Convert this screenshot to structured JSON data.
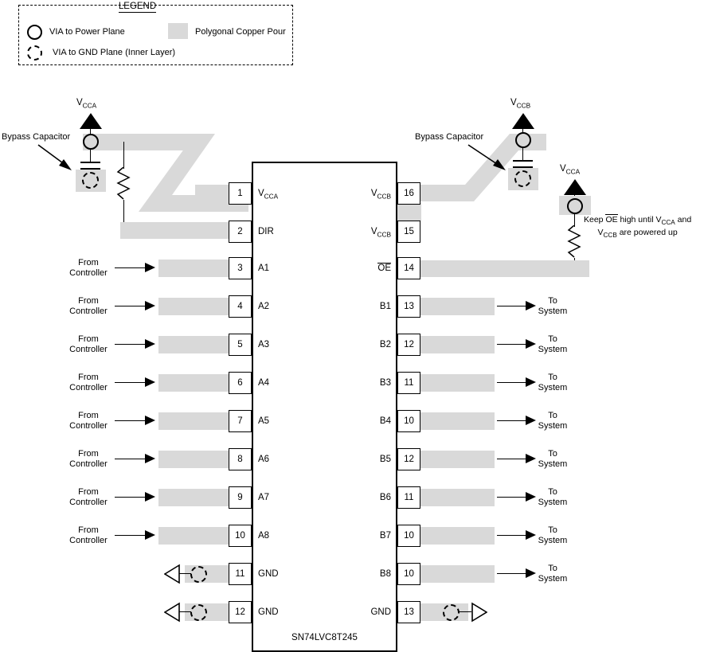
{
  "legend": {
    "title": "LEGEND",
    "items": [
      {
        "icon": "via-power-plane-icon",
        "label": "VIA to Power Plane"
      },
      {
        "icon": "via-gnd-plane-icon",
        "label": "VIA to GND Plane (Inner Layer)"
      },
      {
        "icon": "copper-pour-swatch",
        "label": "Polygonal Copper Pour"
      }
    ]
  },
  "colors": {
    "copper_pour": "#d9d9d9",
    "outline": "#000000",
    "background": "#ffffff"
  },
  "device": {
    "part_number": "SN74LVC8T245"
  },
  "power": {
    "left_rail_label": "V",
    "left_rail_sub": "CCA",
    "right_rail_label": "V",
    "right_rail_sub": "CCB",
    "pullup_rail_label": "V",
    "pullup_rail_sub": "CCA",
    "bypass_callout_left": "Bypass Capacitor",
    "bypass_callout_right": "Bypass Capacitor"
  },
  "note": {
    "line1_pre": "Keep ",
    "line1_oe": "OE",
    "line1_mid": " high until V",
    "line1_sub": "CCA",
    "line1_post": " and",
    "line2_pre": "V",
    "line2_sub": "CCB",
    "line2_post": " are powered up"
  },
  "pins_left": [
    {
      "number": "1",
      "name": "V",
      "sub": "CCA",
      "io": "",
      "overline": false
    },
    {
      "number": "2",
      "name": "DIR",
      "sub": "",
      "io": "",
      "overline": false
    },
    {
      "number": "3",
      "name": "A1",
      "sub": "",
      "io": "From\nController",
      "overline": false
    },
    {
      "number": "4",
      "name": "A2",
      "sub": "",
      "io": "From\nController",
      "overline": false
    },
    {
      "number": "5",
      "name": "A3",
      "sub": "",
      "io": "From\nController",
      "overline": false
    },
    {
      "number": "6",
      "name": "A4",
      "sub": "",
      "io": "From\nController",
      "overline": false
    },
    {
      "number": "7",
      "name": "A5",
      "sub": "",
      "io": "From\nController",
      "overline": false
    },
    {
      "number": "8",
      "name": "A6",
      "sub": "",
      "io": "From\nController",
      "overline": false
    },
    {
      "number": "9",
      "name": "A7",
      "sub": "",
      "io": "From\nController",
      "overline": false
    },
    {
      "number": "10",
      "name": "A8",
      "sub": "",
      "io": "From\nController",
      "overline": false
    },
    {
      "number": "11",
      "name": "GND",
      "sub": "",
      "io": "",
      "overline": false
    },
    {
      "number": "12",
      "name": "GND",
      "sub": "",
      "io": "",
      "overline": false
    }
  ],
  "pins_right": [
    {
      "number": "16",
      "name": "V",
      "sub": "CCB",
      "io": "",
      "overline": false
    },
    {
      "number": "15",
      "name": "V",
      "sub": "CCB",
      "io": "",
      "overline": false
    },
    {
      "number": "14",
      "name": "OE",
      "sub": "",
      "io": "",
      "overline": true
    },
    {
      "number": "13",
      "name": "B1",
      "sub": "",
      "io": "To\nSystem",
      "overline": false
    },
    {
      "number": "12",
      "name": "B2",
      "sub": "",
      "io": "To\nSystem",
      "overline": false
    },
    {
      "number": "11",
      "name": "B3",
      "sub": "",
      "io": "To\nSystem",
      "overline": false
    },
    {
      "number": "10",
      "name": "B4",
      "sub": "",
      "io": "To\nSystem",
      "overline": false
    },
    {
      "number": "12",
      "name": "B5",
      "sub": "",
      "io": "To\nSystem",
      "overline": false
    },
    {
      "number": "11",
      "name": "B6",
      "sub": "",
      "io": "To\nSystem",
      "overline": false
    },
    {
      "number": "10",
      "name": "B7",
      "sub": "",
      "io": "To\nSystem",
      "overline": false
    },
    {
      "number": "10",
      "name": "B8",
      "sub": "",
      "io": "To\nSystem",
      "overline": false
    },
    {
      "number": "13",
      "name": "GND",
      "sub": "",
      "io": "",
      "overline": false
    }
  ]
}
